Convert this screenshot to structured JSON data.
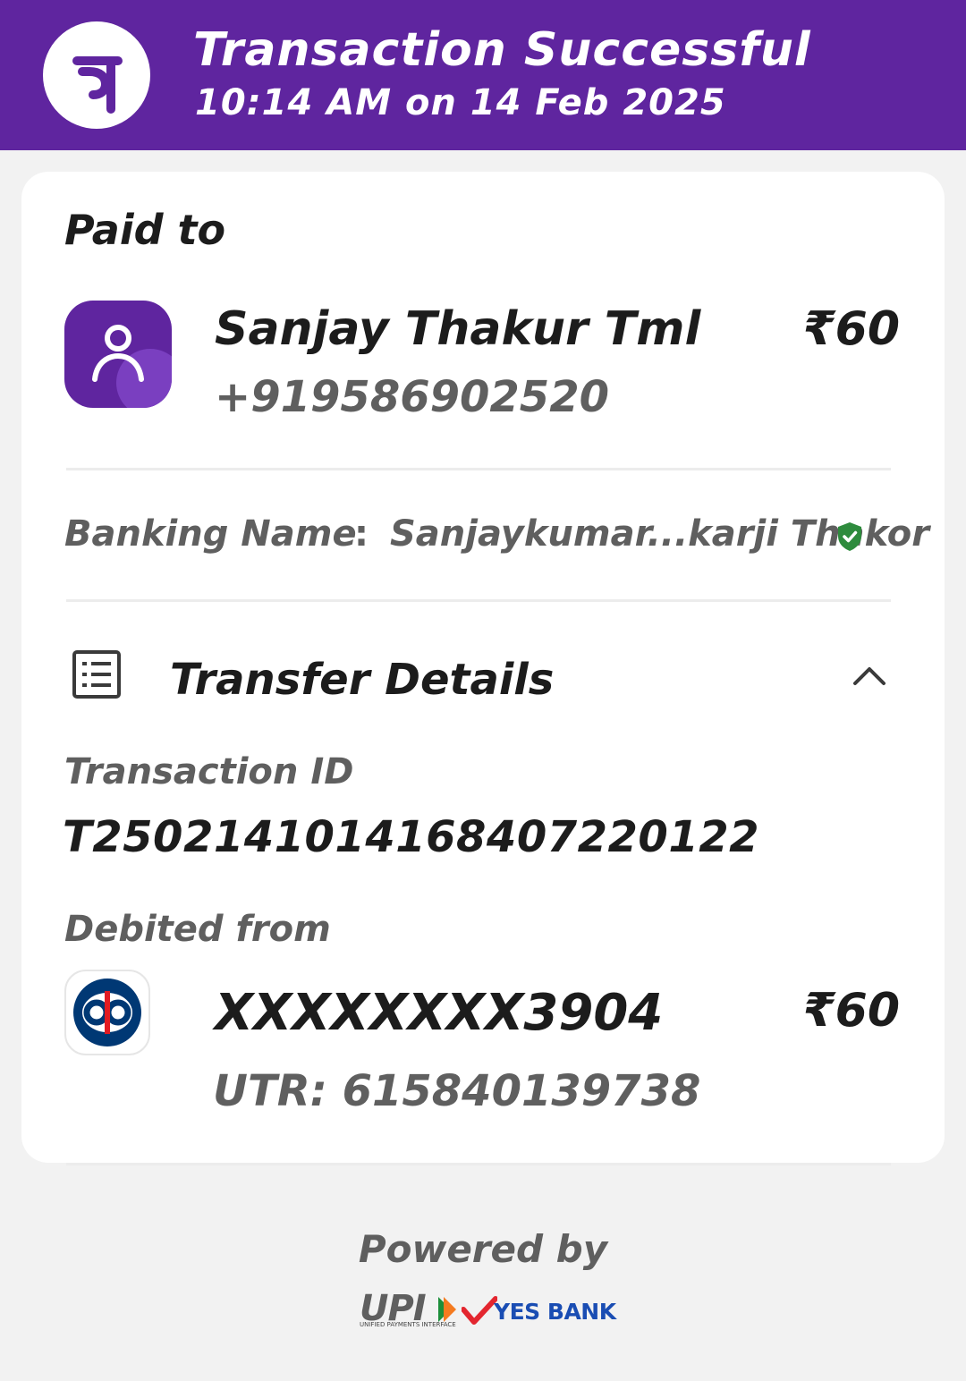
{
  "header": {
    "title": "Transaction Successful",
    "subtitle": "10:14 AM on 14 Feb 2025",
    "brand_color": "#5f259f",
    "logo_icon": "phonepe-logo-icon"
  },
  "paid_to": {
    "label": "Paid to",
    "name": "Sanjay Thakur Tml",
    "phone": "+919586902520",
    "amount": "₹60",
    "avatar_icon": "user-avatar-icon"
  },
  "banking": {
    "label": "Banking Name",
    "separator": ":",
    "value": "Sanjaykumar...karji Thakor",
    "verified_icon": "verified-shield-icon",
    "verified_color": "#2e8b3d"
  },
  "transfer": {
    "title": "Transfer Details",
    "icon": "receipt-list-icon",
    "toggle_icon": "chevron-up-icon",
    "transaction_id_label": "Transaction ID",
    "transaction_id": "T2502141014168407220122",
    "debited_label": "Debited from",
    "account_number": "XXXXXXXX3904",
    "amount": "₹60",
    "utr": "UTR: 615840139738",
    "bank_logo_icon": "kotak-bank-logo-icon"
  },
  "footer": {
    "powered_by": "Powered by",
    "upi_text": "UPI",
    "upi_sub": "UNIFIED PAYMENTS INTERFACE",
    "bank_text": "YES BANK"
  }
}
